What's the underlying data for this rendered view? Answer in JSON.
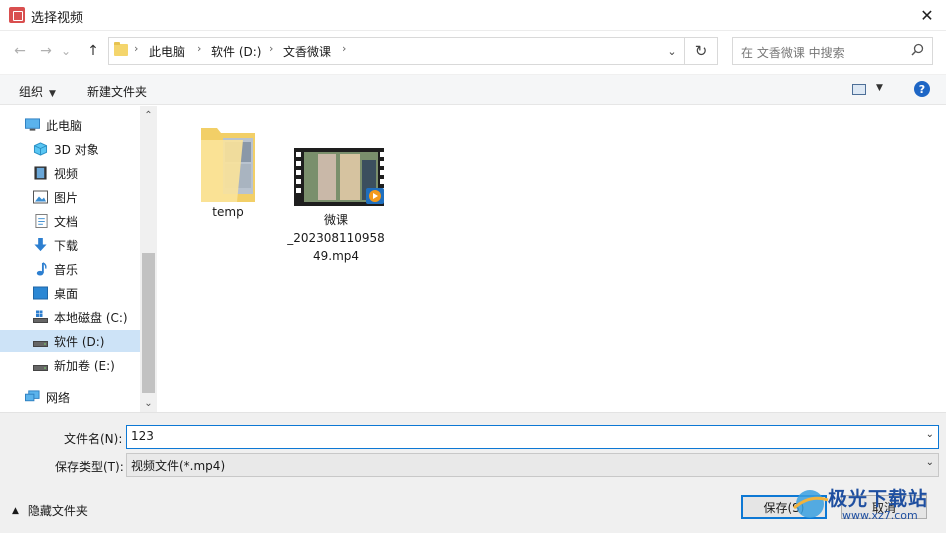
{
  "window": {
    "title": "选择视频",
    "close_glyph": "✕"
  },
  "nav": {
    "back_glyph": "←",
    "forward_glyph": "→",
    "dropdown_glyph": "⌄",
    "up_glyph": "↑",
    "breadcrumbs": [
      "此电脑",
      "软件 (D:)",
      "文香微课"
    ],
    "refresh_glyph": "↻",
    "search_placeholder": "在 文香微课 中搜索"
  },
  "toolbar": {
    "organize": "组织",
    "new_folder": "新建文件夹",
    "help_glyph": "?"
  },
  "sidebar": {
    "items": [
      {
        "label": "此电脑",
        "icon": "computer-icon"
      },
      {
        "label": "3D 对象",
        "icon": "cube-icon"
      },
      {
        "label": "视频",
        "icon": "video-icon"
      },
      {
        "label": "图片",
        "icon": "picture-icon"
      },
      {
        "label": "文档",
        "icon": "document-icon"
      },
      {
        "label": "下载",
        "icon": "download-icon"
      },
      {
        "label": "音乐",
        "icon": "music-icon"
      },
      {
        "label": "桌面",
        "icon": "desktop-icon"
      },
      {
        "label": "本地磁盘 (C:)",
        "icon": "drive-icon"
      },
      {
        "label": "软件 (D:)",
        "icon": "drive-icon",
        "selected": true
      },
      {
        "label": "新加卷 (E:)",
        "icon": "drive-icon"
      },
      {
        "label": "网络",
        "icon": "network-icon"
      }
    ]
  },
  "files": [
    {
      "name": "temp",
      "type": "folder"
    },
    {
      "name_lines": [
        "微课",
        "_202308110958",
        "49.mp4"
      ],
      "type": "video"
    }
  ],
  "footer": {
    "filename_label": "文件名(N):",
    "filename_value": "123",
    "filetype_label": "保存类型(T):",
    "filetype_value": "视频文件(*.mp4)",
    "hide_folders": "隐藏文件夹",
    "save": "保存(S)",
    "cancel": "取消"
  },
  "watermark": {
    "brand": "极光下载站",
    "url": "www.xz7.com"
  }
}
